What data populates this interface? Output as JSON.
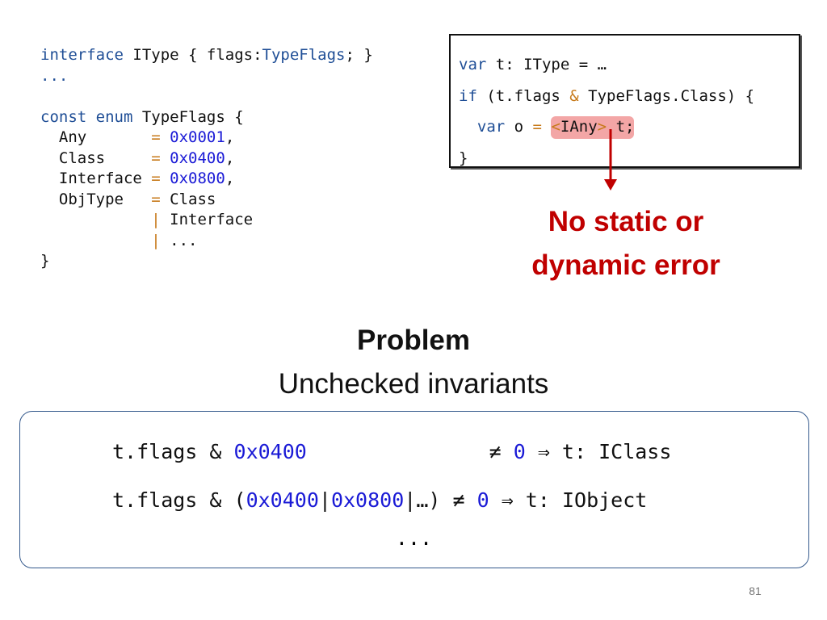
{
  "left_code": {
    "line1": {
      "kw": "interface",
      "a": " IType { flags:",
      "type": "TypeFlags",
      "b": "; }"
    },
    "ellipsis": "...",
    "enum_kw": "const enum",
    "enum_name": " TypeFlags {",
    "members": [
      {
        "pad": "  Any       ",
        "op": "=",
        "val": " 0x0001",
        "tail": ","
      },
      {
        "pad": "  Class     ",
        "op": "=",
        "val": " 0x0400",
        "tail": ","
      },
      {
        "pad": "  Interface ",
        "op": "=",
        "val": " 0x0800",
        "tail": ","
      }
    ],
    "objtype": {
      "pad": "  ObjType   ",
      "op": "=",
      "rest": " Class"
    },
    "cont1": {
      "pad": "            ",
      "op": "|",
      "rest": " Interface"
    },
    "cont2": {
      "pad": "            ",
      "op": "|",
      "rest": " ..."
    },
    "close": "}"
  },
  "right_code": {
    "line1_kw": "var",
    "line1_rest": " t: IType = …",
    "line2_kw": "if",
    "line2_a": " (t.flags ",
    "line2_op": "&",
    "line2_b": " TypeFlags.Class) {",
    "line3_pad": "  ",
    "line3_kw": "var",
    "line3_a": " o ",
    "line3_op": "=",
    "line3_space": " ",
    "cast_lt": "<",
    "cast_type": "IAny",
    "cast_gt": ">",
    "cast_rest": " t;",
    "line4": "}"
  },
  "annotation": {
    "line1": "No static or",
    "line2": "dynamic error",
    "color": "#c00000"
  },
  "problem": {
    "heading": "Problem",
    "subtitle": "Unchecked invariants"
  },
  "invariants": {
    "row1": {
      "a": "t.flags & ",
      "hex": "0x0400",
      "gap": "               ",
      "neq": "≠ ",
      "zero": "0",
      "rest": " ⇒ t: IClass"
    },
    "row2": {
      "a": "t.flags & (",
      "hex1": "0x0400",
      "bar1": "|",
      "hex2": "0x0800",
      "bar2": "|…) ",
      "neq": "≠ ",
      "zero": "0",
      "rest": " ⇒ t: IObject"
    },
    "ellipsis": "..."
  },
  "page_number": "81"
}
